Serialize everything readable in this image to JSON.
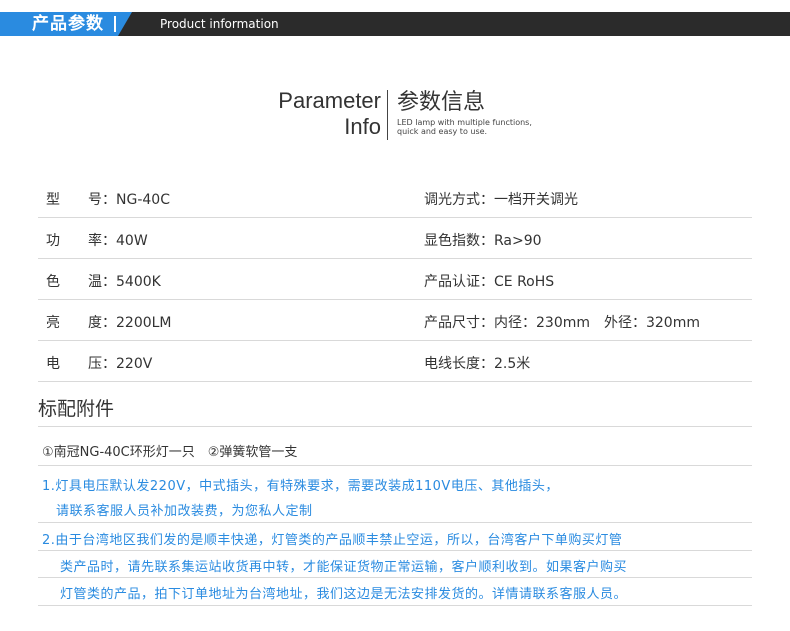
{
  "header": {
    "title_cn": "产品参数",
    "title_en": "Product information",
    "accent_color": "#2a8be0"
  },
  "title": {
    "en_line1": "Parameter",
    "en_line2": "Info",
    "cn": "参数信息",
    "sub_line1": "LED lamp with multiple functions,",
    "sub_line2": "quick and easy to use."
  },
  "specs": [
    {
      "left_label": "型　　号：",
      "left_value": "NG-40C",
      "right_label": "调光方式：",
      "right_value": "一档开关调光"
    },
    {
      "left_label": "功　　率：",
      "left_value": "40W",
      "right_label": "显色指数：",
      "right_value": "Ra>90"
    },
    {
      "left_label": "色　　温：",
      "left_value": "5400K",
      "right_label": "产品认证：",
      "right_value": "CE RoHS"
    },
    {
      "left_label": "亮　　度：",
      "left_value": "2200LM",
      "right_label": "产品尺寸：",
      "right_value": "内径：230mm　外径：320mm"
    },
    {
      "left_label": "电　　压：",
      "left_value": "220V",
      "right_label": "电线长度：",
      "right_value": "2.5米"
    }
  ],
  "accessories": {
    "title": "标配附件",
    "items": "①南冠NG-40C环形灯一只　②弹簧软管一支"
  },
  "notes": [
    "1.灯具电压默认发220V，中式插头，有特殊要求，需要改装成110V电压、其他插头，",
    "请联系客服人员补加改装费，为您私人定制",
    "2.由于台湾地区我们发的是顺丰快递，灯管类的产品顺丰禁止空运，所以，台湾客户下单购买灯管",
    "类产品时，请先联系集运站收货再中转，才能保证货物正常运输，客户顺利收到。如果客户购买",
    "灯管类的产品，拍下订单地址为台湾地址，我们这边是无法安排发货的。详情请联系客服人员。"
  ]
}
